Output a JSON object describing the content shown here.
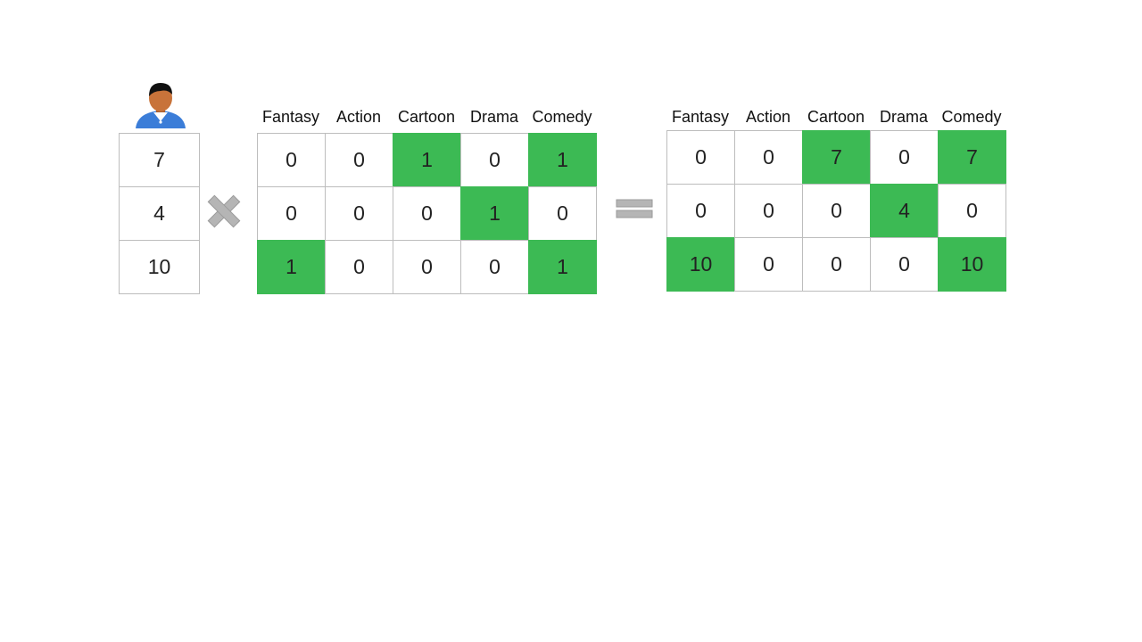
{
  "user_vector": {
    "values": [
      "7",
      "4",
      "10"
    ]
  },
  "operators": {
    "multiply_icon": "multiply-icon",
    "equals_icon": "equals-icon"
  },
  "genre_matrix": {
    "headers": [
      "Fantasy",
      "Action",
      "Cartoon",
      "Drama",
      "Comedy"
    ],
    "rows": [
      [
        "0",
        "0",
        "1",
        "0",
        "1"
      ],
      [
        "0",
        "0",
        "0",
        "1",
        "0"
      ],
      [
        "1",
        "0",
        "0",
        "0",
        "1"
      ]
    ],
    "highlight": [
      [
        false,
        false,
        true,
        false,
        true
      ],
      [
        false,
        false,
        false,
        true,
        false
      ],
      [
        true,
        false,
        false,
        false,
        true
      ]
    ]
  },
  "result_matrix": {
    "headers": [
      "Fantasy",
      "Action",
      "Cartoon",
      "Drama",
      "Comedy"
    ],
    "rows": [
      [
        "0",
        "0",
        "7",
        "0",
        "7"
      ],
      [
        "0",
        "0",
        "0",
        "4",
        "0"
      ],
      [
        "10",
        "0",
        "0",
        "0",
        "10"
      ]
    ],
    "highlight": [
      [
        false,
        false,
        true,
        false,
        true
      ],
      [
        false,
        false,
        false,
        true,
        false
      ],
      [
        true,
        false,
        false,
        false,
        true
      ]
    ]
  },
  "colors": {
    "highlight": "#3cba54",
    "border": "#bdbdbd",
    "operator": "#b5b5b5",
    "avatar_shirt": "#3b7dd8",
    "avatar_skin": "#c8733a"
  }
}
